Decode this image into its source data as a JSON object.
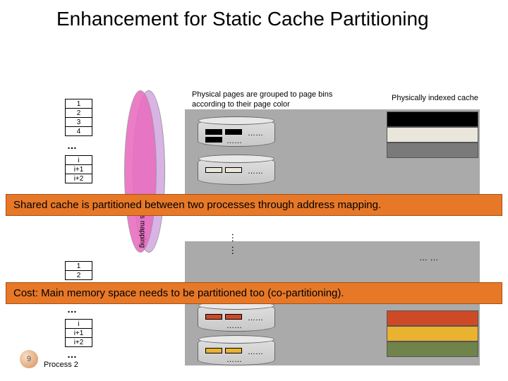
{
  "title": "Enhancement for Static Cache Partitioning",
  "captions": {
    "pagebins": "Physical pages are grouped to page bins according to their page color",
    "cache": "Physically indexed cache"
  },
  "process1": {
    "rows_a": [
      "1",
      "2",
      "3",
      "4"
    ],
    "rows_b": [
      "i",
      "i+1",
      "i+2"
    ],
    "label": ""
  },
  "process2": {
    "rows_a": [
      "1",
      "2"
    ],
    "rows_b": [
      "i",
      "i+1",
      "i+2"
    ],
    "label": "Process 2"
  },
  "mapping_label": "ss mapping",
  "banners": {
    "shared": "Shared cache is partitioned between two processes through address mapping.",
    "cost": "Cost: Main memory space needs to be partitioned too (co-partitioning)."
  },
  "bindots": "……",
  "vdots": "… …",
  "cache_sep": "… …",
  "slide_number": "9",
  "colors": {
    "row1": "#000000",
    "row2": "#eae6dc",
    "row3": "#7a7a7a",
    "row6": "#ce4a26",
    "row7": "#e9b22f",
    "row8": "#6f834a"
  }
}
